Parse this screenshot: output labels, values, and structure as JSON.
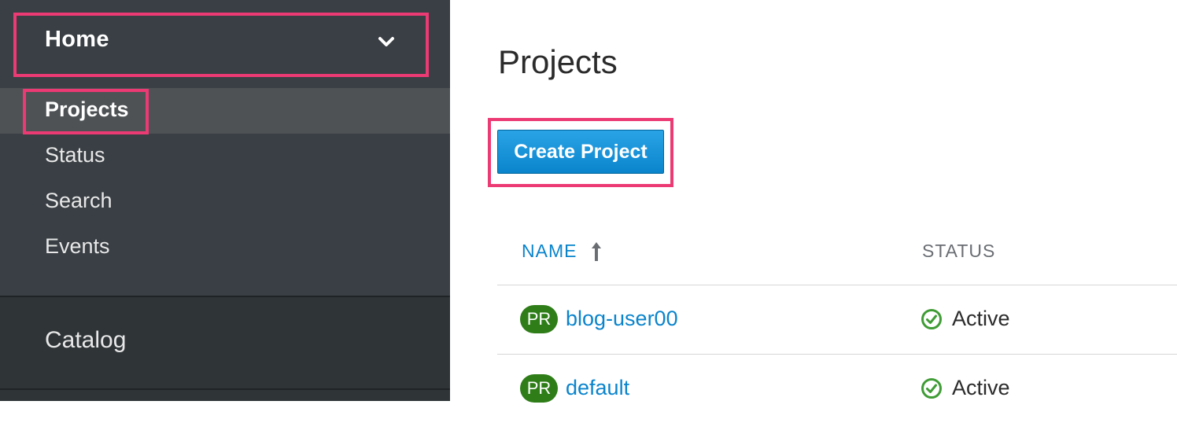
{
  "sidebar": {
    "home_label": "Home",
    "items": [
      {
        "label": "Projects",
        "active": true
      },
      {
        "label": "Status",
        "active": false
      },
      {
        "label": "Search",
        "active": false
      },
      {
        "label": "Events",
        "active": false
      }
    ],
    "catalog_label": "Catalog"
  },
  "main": {
    "title": "Projects",
    "create_button": "Create Project",
    "table": {
      "columns": [
        "NAME",
        "STATUS"
      ],
      "sort": "ascending",
      "rows": [
        {
          "badge": "PR",
          "name": "blog-user00",
          "status": "Active"
        },
        {
          "badge": "PR",
          "name": "default",
          "status": "Active"
        }
      ]
    }
  },
  "colors": {
    "highlight": "#ec3a74",
    "sidebar_bg": "#393f44",
    "link": "#0a84cc",
    "badge": "#2e7d18",
    "status_ok": "#3f9c35"
  },
  "icons": {
    "home_toggle": "chevron-down-icon",
    "sort": "sort-ascending-arrow-icon",
    "status": "check-circle-icon"
  }
}
